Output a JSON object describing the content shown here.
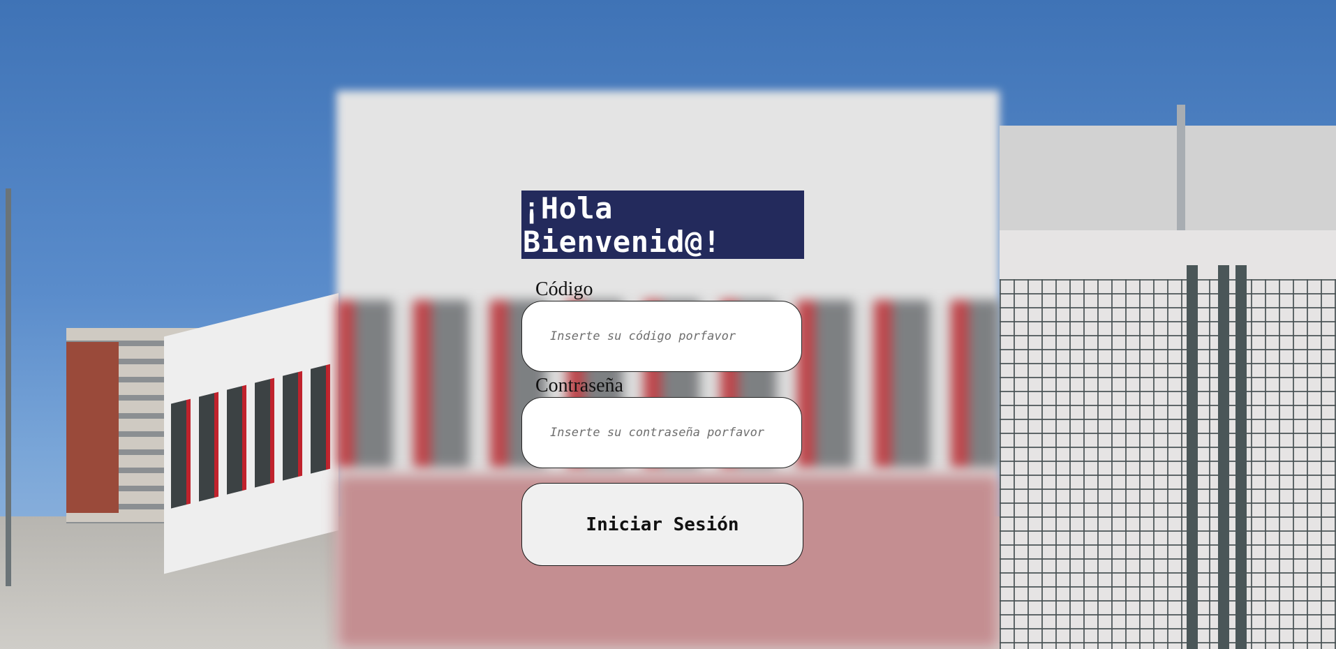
{
  "page": {
    "title": "¡Hola Bienvenid@!"
  },
  "form": {
    "code_label": "Código",
    "code_placeholder": "Inserte su código porfavor",
    "password_label": "Contraseña",
    "password_placeholder": "Inserte su contraseña porfavor",
    "submit_label": "Iniciar Sesión"
  },
  "colors": {
    "title_background": "#232a5c",
    "title_text": "#ffffff",
    "input_background": "#ffffff",
    "button_background": "#f0f0f0"
  },
  "background": {
    "description_icon": "school-building-photo"
  }
}
